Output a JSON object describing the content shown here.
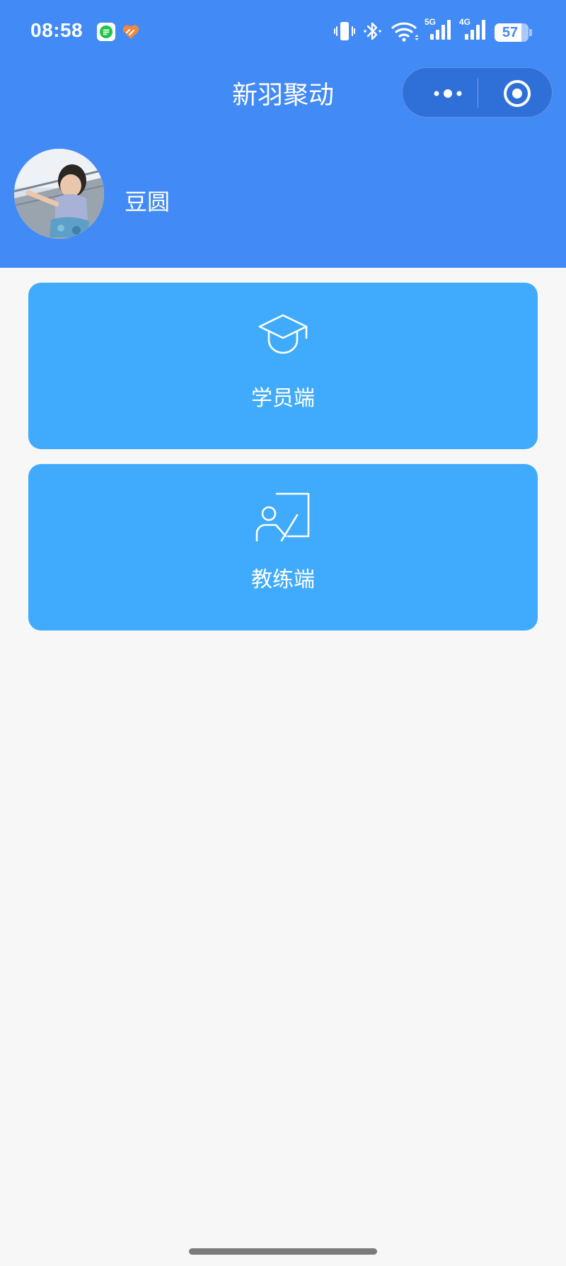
{
  "status_bar": {
    "time": "08:58",
    "notification_icons": [
      "chat-app-icon",
      "health-app-icon"
    ],
    "system_icons": [
      "vibrate-icon",
      "bluetooth-icon",
      "wifi-icon",
      "signal-5g-icon",
      "signal-4g-icon"
    ],
    "network_5g": "5G",
    "network_4g": "4G",
    "battery": "57"
  },
  "header": {
    "title": "新羽聚动",
    "capsule": {
      "more_icon": "more-dots-icon",
      "close_icon": "target-circle-icon"
    },
    "background_color": "#428af5"
  },
  "profile": {
    "username": "豆圆",
    "avatar": "user-avatar-photo"
  },
  "cards": [
    {
      "label": "学员端",
      "icon": "graduation-cap-icon",
      "color": "#40abfc"
    },
    {
      "label": "教练端",
      "icon": "teacher-board-icon",
      "color": "#40abfc"
    }
  ]
}
